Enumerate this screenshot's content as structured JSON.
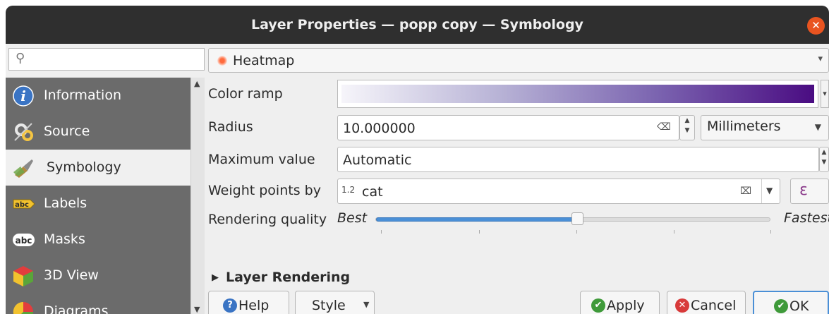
{
  "window": {
    "title": "Layer Properties — popp copy — Symbology",
    "close_glyph": "✕"
  },
  "sidebar": {
    "search_placeholder": "",
    "search_icon": "⚲",
    "items": [
      {
        "label": "Information",
        "icon": "info-icon"
      },
      {
        "label": "Source",
        "icon": "source-icon"
      },
      {
        "label": "Symbology",
        "icon": "symbology-icon",
        "active": true
      },
      {
        "label": "Labels",
        "icon": "labels-icon"
      },
      {
        "label": "Masks",
        "icon": "masks-icon"
      },
      {
        "label": "3D View",
        "icon": "3d-view-icon"
      },
      {
        "label": "Diagrams",
        "icon": "diagrams-icon"
      }
    ]
  },
  "renderer": {
    "selected": "Heatmap",
    "arrow": "▾"
  },
  "form": {
    "color_ramp_label": "Color ramp",
    "color_ramp_colors": [
      "#f6f5fa",
      "#b8b3d6",
      "#7b64b0",
      "#4a0c82"
    ],
    "radius_label": "Radius",
    "radius_value": "10.000000",
    "radius_unit": "Millimeters",
    "max_value_label": "Maximum value",
    "max_value_value": "Automatic",
    "weight_label": "Weight points by",
    "weight_type_prefix": "1.2",
    "weight_value": "cat",
    "expression_glyph": "ε",
    "quality_label": "Rendering quality",
    "quality_best": "Best",
    "quality_fastest": "Fastest",
    "quality_level": 0.51
  },
  "section": {
    "layer_rendering": "Layer Rendering",
    "arrow": "▶"
  },
  "buttons": {
    "help": "Help",
    "style": "Style",
    "apply": "Apply",
    "cancel": "Cancel",
    "ok": "OK"
  },
  "colors": {
    "accent": "#4a8fd6",
    "close": "#e95420",
    "sidebar_bg": "#6b6b6b"
  }
}
